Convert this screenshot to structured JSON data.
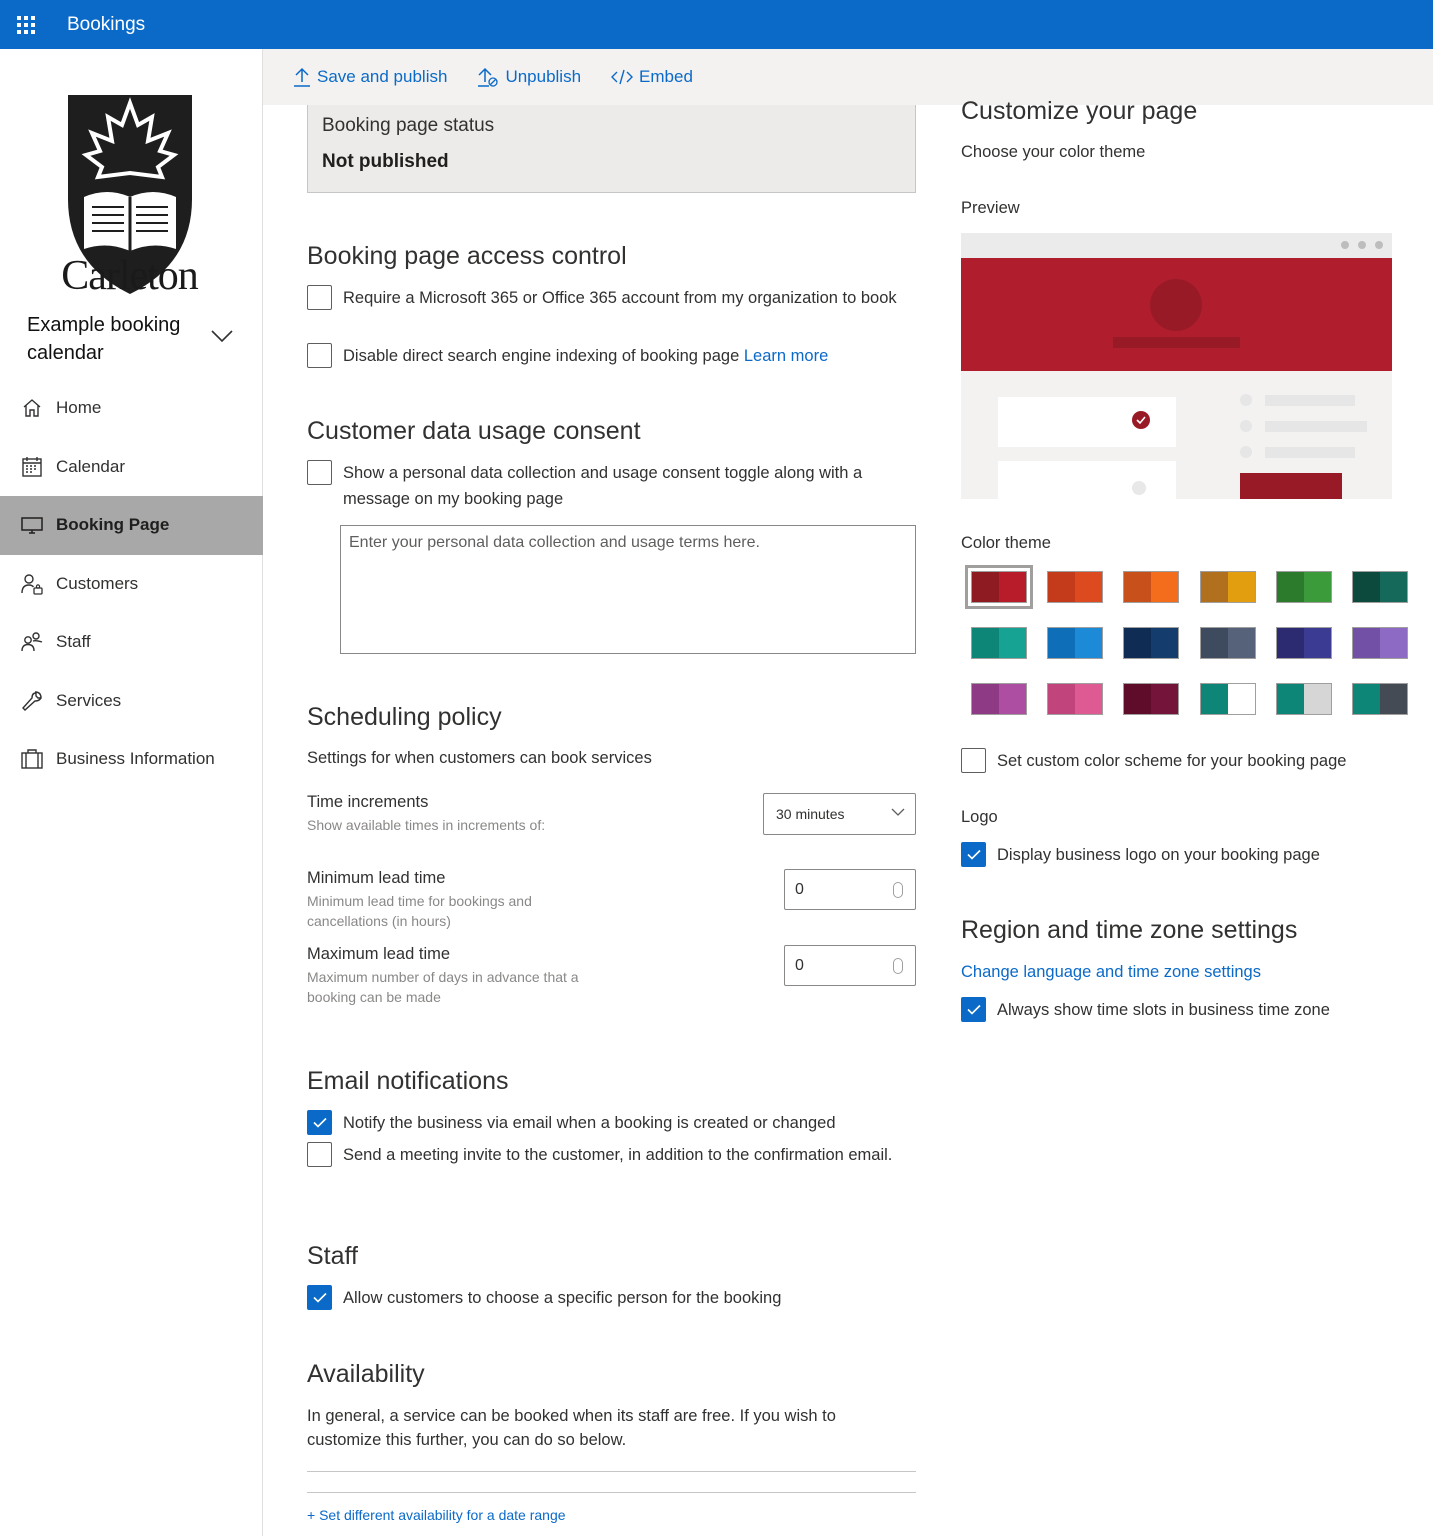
{
  "app": {
    "title": "Bookings"
  },
  "sidebar": {
    "logo_text": "Carleton",
    "calendar_name": "Example booking calendar",
    "items": [
      {
        "label": "Home",
        "icon": "home-icon"
      },
      {
        "label": "Calendar",
        "icon": "calendar-icon"
      },
      {
        "label": "Booking Page",
        "icon": "monitor-icon",
        "active": true
      },
      {
        "label": "Customers",
        "icon": "customers-icon"
      },
      {
        "label": "Staff",
        "icon": "staff-icon"
      },
      {
        "label": "Services",
        "icon": "wrench-icon"
      },
      {
        "label": "Business Information",
        "icon": "briefcase-icon"
      }
    ]
  },
  "toolbar": {
    "save_publish": "Save and publish",
    "unpublish": "Unpublish",
    "embed": "Embed"
  },
  "status": {
    "label": "Booking page status",
    "value": "Not published"
  },
  "access": {
    "title": "Booking page access control",
    "require_account": "Require a Microsoft 365 or Office 365 account from my organization to book",
    "disable_indexing": "Disable direct search engine indexing of booking page",
    "learn_more": "Learn more"
  },
  "consent": {
    "title": "Customer data usage consent",
    "toggle_label": "Show a personal data collection and usage consent toggle along with a message on my booking page",
    "terms_placeholder": "Enter your personal data collection and usage terms here."
  },
  "scheduling": {
    "title": "Scheduling policy",
    "subtitle": "Settings for when customers can book services",
    "time_increments_label": "Time increments",
    "time_increments_help": "Show available times in increments of:",
    "time_increments_value": "30 minutes",
    "min_lead_label": "Minimum lead time",
    "min_lead_help": "Minimum lead time for bookings and cancellations (in hours)",
    "min_lead_value": "0",
    "max_lead_label": "Maximum lead time",
    "max_lead_help": "Maximum number of days in advance that a booking can be made",
    "max_lead_value": "0"
  },
  "email": {
    "title": "Email notifications",
    "notify_business": "Notify the business via email when a booking is created or changed",
    "notify_business_checked": true,
    "send_invite": "Send a meeting invite to the customer, in addition to the confirmation email.",
    "send_invite_checked": false
  },
  "staff": {
    "title": "Staff",
    "allow_choose": "Allow customers to choose a specific person for the booking",
    "allow_choose_checked": true
  },
  "availability": {
    "title": "Availability",
    "description": "In general, a service can be booked when its staff are free. If you wish to customize this further, you can do so below.",
    "date_range_link": "+ Set different availability for a date range"
  },
  "customize": {
    "title": "Customize your page",
    "subtitle": "Choose your color theme",
    "preview_label": "Preview",
    "preview_color": "#b01e2d",
    "color_theme_label": "Color theme",
    "swatches": [
      [
        "#8e1a22",
        "#b81c2b"
      ],
      [
        "#c43b1c",
        "#de4a1f"
      ],
      [
        "#c8501a",
        "#f46d1d"
      ],
      [
        "#b0701e",
        "#e39e10"
      ],
      [
        "#2c7a2c",
        "#3b9b3b"
      ],
      [
        "#0c4a3e",
        "#14695a"
      ],
      [
        "#0d8577",
        "#17a394"
      ],
      [
        "#0e6eb8",
        "#1d8ad8"
      ],
      [
        "#0f2d54",
        "#143d6e"
      ],
      [
        "#3e4a5e",
        "#55627a"
      ],
      [
        "#2c2b72",
        "#3c3b94"
      ],
      [
        "#7150a6",
        "#8d6bc4"
      ],
      [
        "#8f3a84",
        "#ad4ea2"
      ],
      [
        "#c2447c",
        "#dd5a93"
      ],
      [
        "#5e0c2a",
        "#74143a"
      ],
      [
        "#0d8577",
        "#ffffff"
      ],
      [
        "#0d8577",
        "#d6d6d6"
      ],
      [
        "#0d8577",
        "#444b55"
      ]
    ],
    "custom_scheme": "Set custom color scheme for your booking page",
    "logo_label": "Logo",
    "display_logo": "Display business logo on your booking page",
    "display_logo_checked": true
  },
  "region": {
    "title": "Region and time zone settings",
    "change_link": "Change language and time zone settings",
    "always_show": "Always show time slots in business time zone",
    "always_show_checked": true
  }
}
